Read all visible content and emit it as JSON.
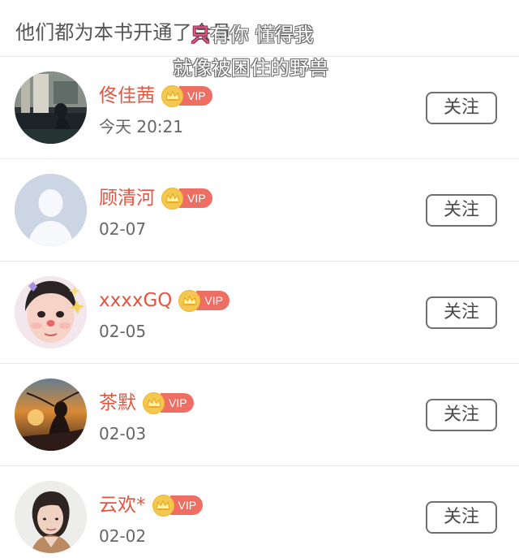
{
  "header": {
    "title": "他们都为本书开通了会员"
  },
  "overlay": {
    "line1_accent": "只",
    "line1_rest": "有你 懂得我",
    "line2": "就像被困住的野兽"
  },
  "colors": {
    "username": "#e3553f",
    "vip_crown": "#f4c850",
    "vip_label": "#ee6e64",
    "button_border": "#6f6f6f",
    "divider": "#e7e7e7"
  },
  "members": [
    {
      "name": "佟佳茜",
      "vip_label": "VIP",
      "date": "今天 20:21",
      "button_label": "关注",
      "avatar_icon": "dark-window-portrait-avatar"
    },
    {
      "name": "顾清河",
      "vip_label": "VIP",
      "date": "02-07",
      "button_label": "关注",
      "avatar_icon": "default-person-avatar"
    },
    {
      "name": "xxxxGQ",
      "vip_label": "VIP",
      "date": "02-05",
      "button_label": "关注",
      "avatar_icon": "cute-face-avatar"
    },
    {
      "name": "茶默",
      "vip_label": "VIP",
      "date": "02-03",
      "button_label": "关注",
      "avatar_icon": "sunset-profile-avatar"
    },
    {
      "name": "云欢*",
      "vip_label": "VIP",
      "date": "02-02",
      "button_label": "关注",
      "avatar_icon": "short-hair-portrait-avatar"
    }
  ]
}
